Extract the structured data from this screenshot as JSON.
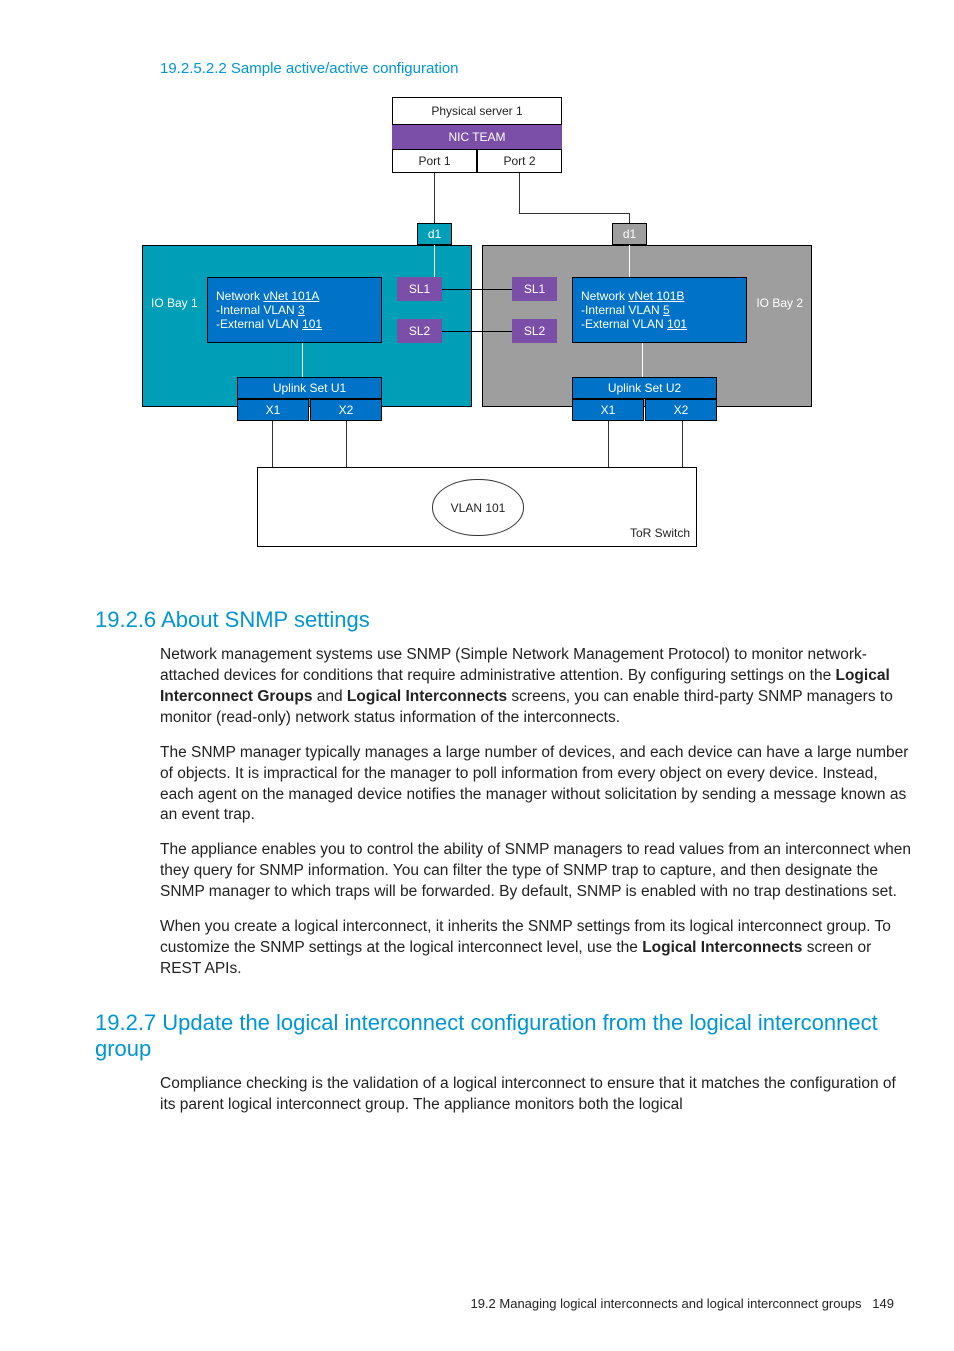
{
  "section_small_title": "19.2.5.2.2 Sample active/active configuration",
  "diagram": {
    "physical_server": "Physical server 1",
    "nic_team": "NIC TEAM",
    "port1": "Port 1",
    "port2": "Port 2",
    "d1_left": "d1",
    "d1_right": "d1",
    "io_bay_1": "IO Bay 1",
    "io_bay_2": "IO Bay 2",
    "vnet_a_name": "Network vNet 101A",
    "vnet_a_int": "-Internal VLAN 3",
    "vnet_a_ext": "-External VLAN 101",
    "vnet_b_name": "Network vNet 101B",
    "vnet_b_int": "-Internal VLAN 5",
    "vnet_b_ext": "-External VLAN 101",
    "sl1_l": "SL1",
    "sl2_l": "SL2",
    "sl1_r": "SL1",
    "sl2_r": "SL2",
    "uplink_u1": "Uplink Set U1",
    "uplink_u2": "Uplink Set U2",
    "x1_l": "X1",
    "x2_l": "X2",
    "x1_r": "X1",
    "x2_r": "X2",
    "vlan101": "VLAN 101",
    "tor": "ToR Switch"
  },
  "heading_snmp": "19.2.6 About SNMP settings",
  "snmp_p1_a": "Network management systems use SNMP (Simple Network Management Protocol) to monitor network-attached devices for conditions that require administrative attention. By configuring settings on the ",
  "snmp_p1_bold1": "Logical Interconnect Groups",
  "snmp_p1_mid": " and ",
  "snmp_p1_bold2": "Logical Interconnects",
  "snmp_p1_b": " screens, you can enable third-party SNMP managers to monitor (read-only) network status information of the interconnects.",
  "snmp_p2": "The SNMP manager typically manages a large number of devices, and each device can have a large number of objects. It is impractical for the manager to poll information from every object on every device. Instead, each agent on the managed device notifies the manager without solicitation by sending a message known as an event trap.",
  "snmp_p3": "The appliance enables you to control the ability of SNMP managers to read values from an interconnect when they query for SNMP information. You can filter the type of SNMP trap to capture, and then designate the SNMP manager to which traps will be forwarded. By default, SNMP is enabled with no trap destinations set.",
  "snmp_p4_a": "When you create a logical interconnect, it inherits the SNMP settings from its logical interconnect group. To customize the SNMP settings at the logical interconnect level, use the ",
  "snmp_p4_bold": "Logical Interconnects",
  "snmp_p4_b": " screen or REST APIs.",
  "heading_update": "19.2.7 Update the logical interconnect configuration from the logical interconnect group",
  "update_p1": "Compliance checking is the validation of a logical interconnect to ensure that it matches the configuration of its parent logical interconnect group. The appliance monitors both the logical",
  "footer_text": "19.2 Managing logical interconnects and logical interconnect groups",
  "footer_page": "149"
}
